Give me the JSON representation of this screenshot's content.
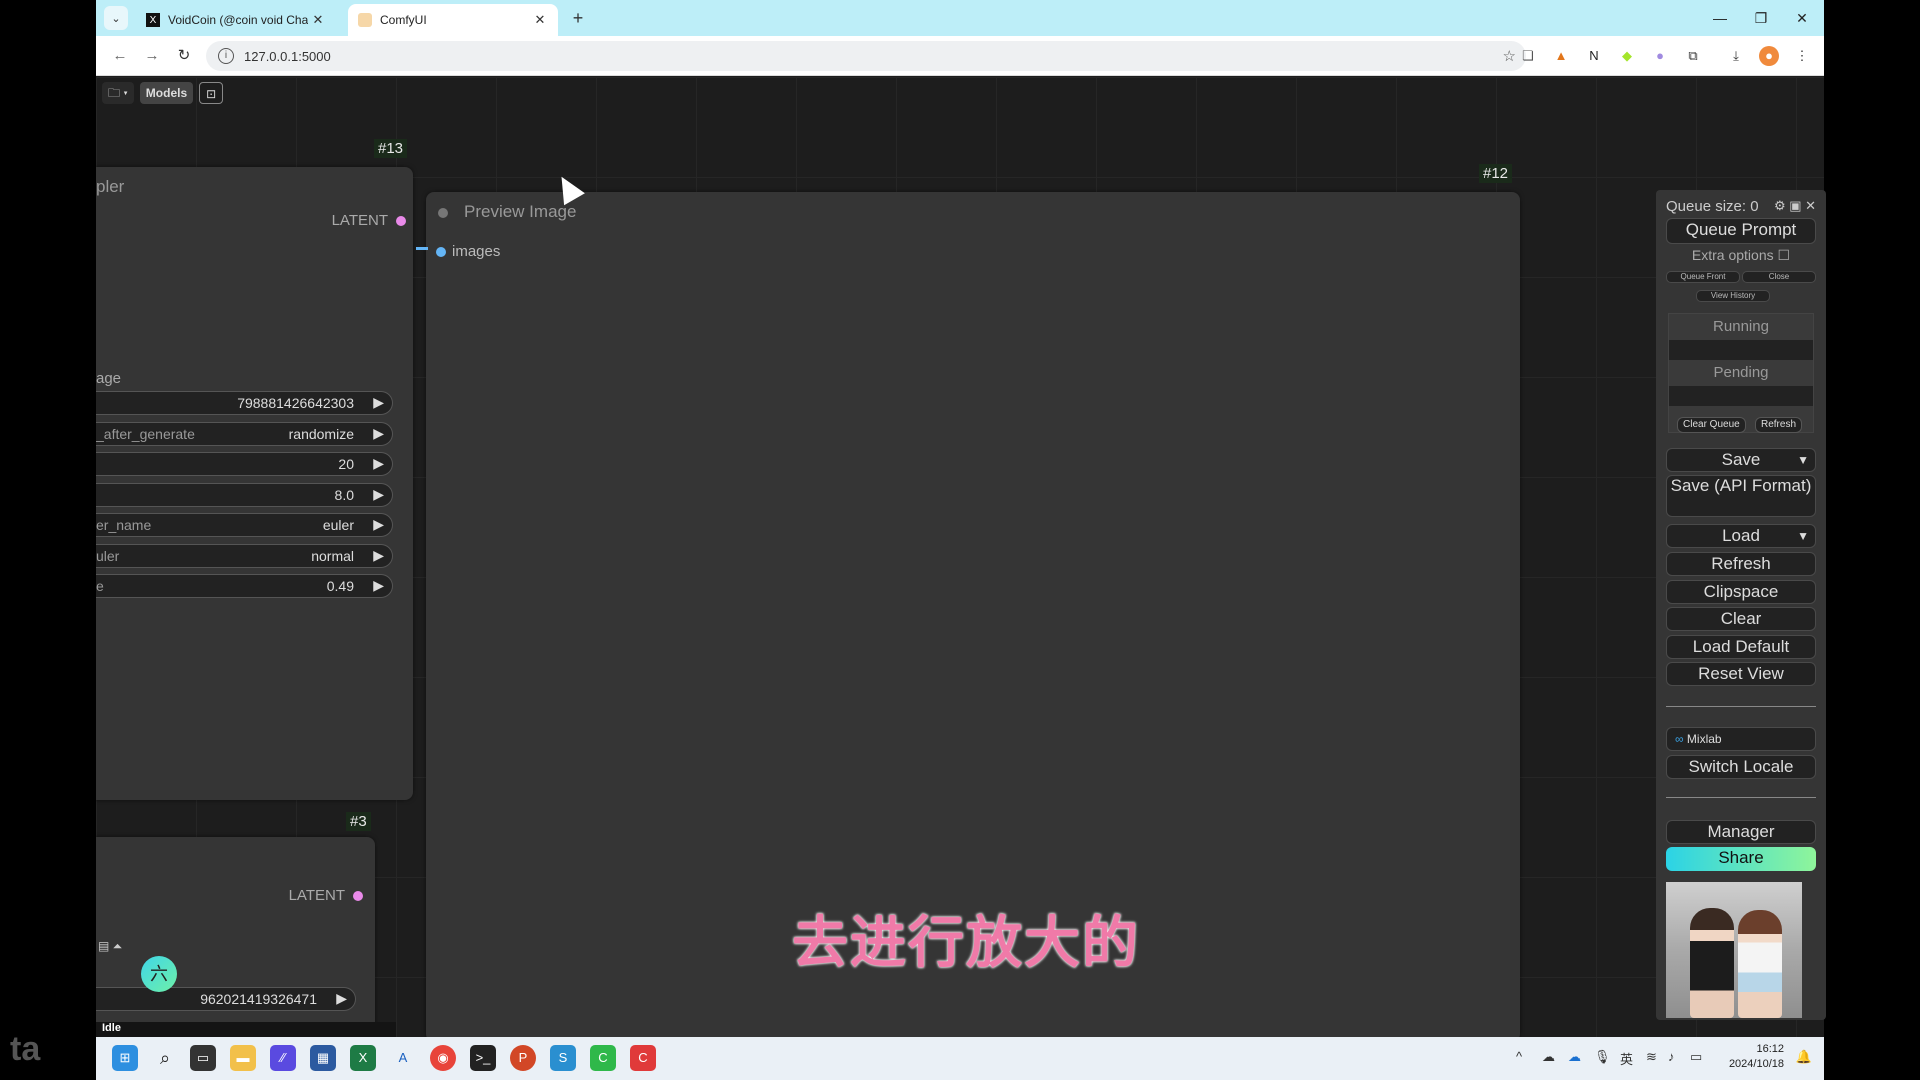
{
  "browser": {
    "tabs": [
      {
        "title": "VoidCoin (@coin void Chain",
        "icon": "x-logo-icon",
        "active": false
      },
      {
        "title": "ComfyUI",
        "icon": "comfyui-favicon",
        "active": true
      }
    ],
    "url": "127.0.0.1:5000",
    "new_tab_glyph": "+",
    "window_controls": {
      "minimize": "—",
      "restore": "❐",
      "close": "✕"
    }
  },
  "comfy": {
    "top_menu": {
      "folder_glyph": "🗀 ▾",
      "models_label": "Models",
      "save_glyph": "⊡"
    },
    "nodes": {
      "ksampler_13": {
        "id_badge": "#13",
        "title_fragment": "pler",
        "output_label": "LATENT",
        "input_fragment": "age",
        "widgets": [
          {
            "label": "",
            "value": "798881426642303"
          },
          {
            "label": "_after_generate",
            "value": "randomize"
          },
          {
            "label": "",
            "value": "20"
          },
          {
            "label": "",
            "value": "8.0"
          },
          {
            "label": "er_name",
            "value": "euler"
          },
          {
            "label": "uler",
            "value": "normal"
          },
          {
            "label": "e",
            "value": "0.49"
          }
        ]
      },
      "preview_12": {
        "id_badge": "#12",
        "title": "Preview Image",
        "input_label": "images"
      },
      "ksampler_3": {
        "id_badge": "#3",
        "output_label": "LATENT",
        "seed_value": "962021419326471"
      }
    },
    "menu": {
      "queue_size": "Queue size: 0",
      "queue_prompt": "Queue Prompt",
      "extra_options": "Extra options",
      "queue_front": "Queue Front",
      "close": "Close",
      "view_history": "View History",
      "running": "Running",
      "pending": "Pending",
      "clear_queue": "Clear Queue",
      "refresh_small": "Refresh",
      "save": "Save",
      "save_api": "Save (API Format)",
      "load": "Load",
      "refresh": "Refresh",
      "clipspace": "Clipspace",
      "clear": "Clear",
      "load_default": "Load Default",
      "reset_view": "Reset View",
      "mixlab": "Mixlab",
      "switch_locale": "Switch Locale",
      "manager": "Manager",
      "share": "Share"
    },
    "status": "Idle",
    "ai_button_glyph": "六"
  },
  "subtitle": "去进行放大的",
  "taskbar": {
    "time": "16:12",
    "date": "2024/10/18",
    "ime": "英"
  },
  "watermark": "ta"
}
